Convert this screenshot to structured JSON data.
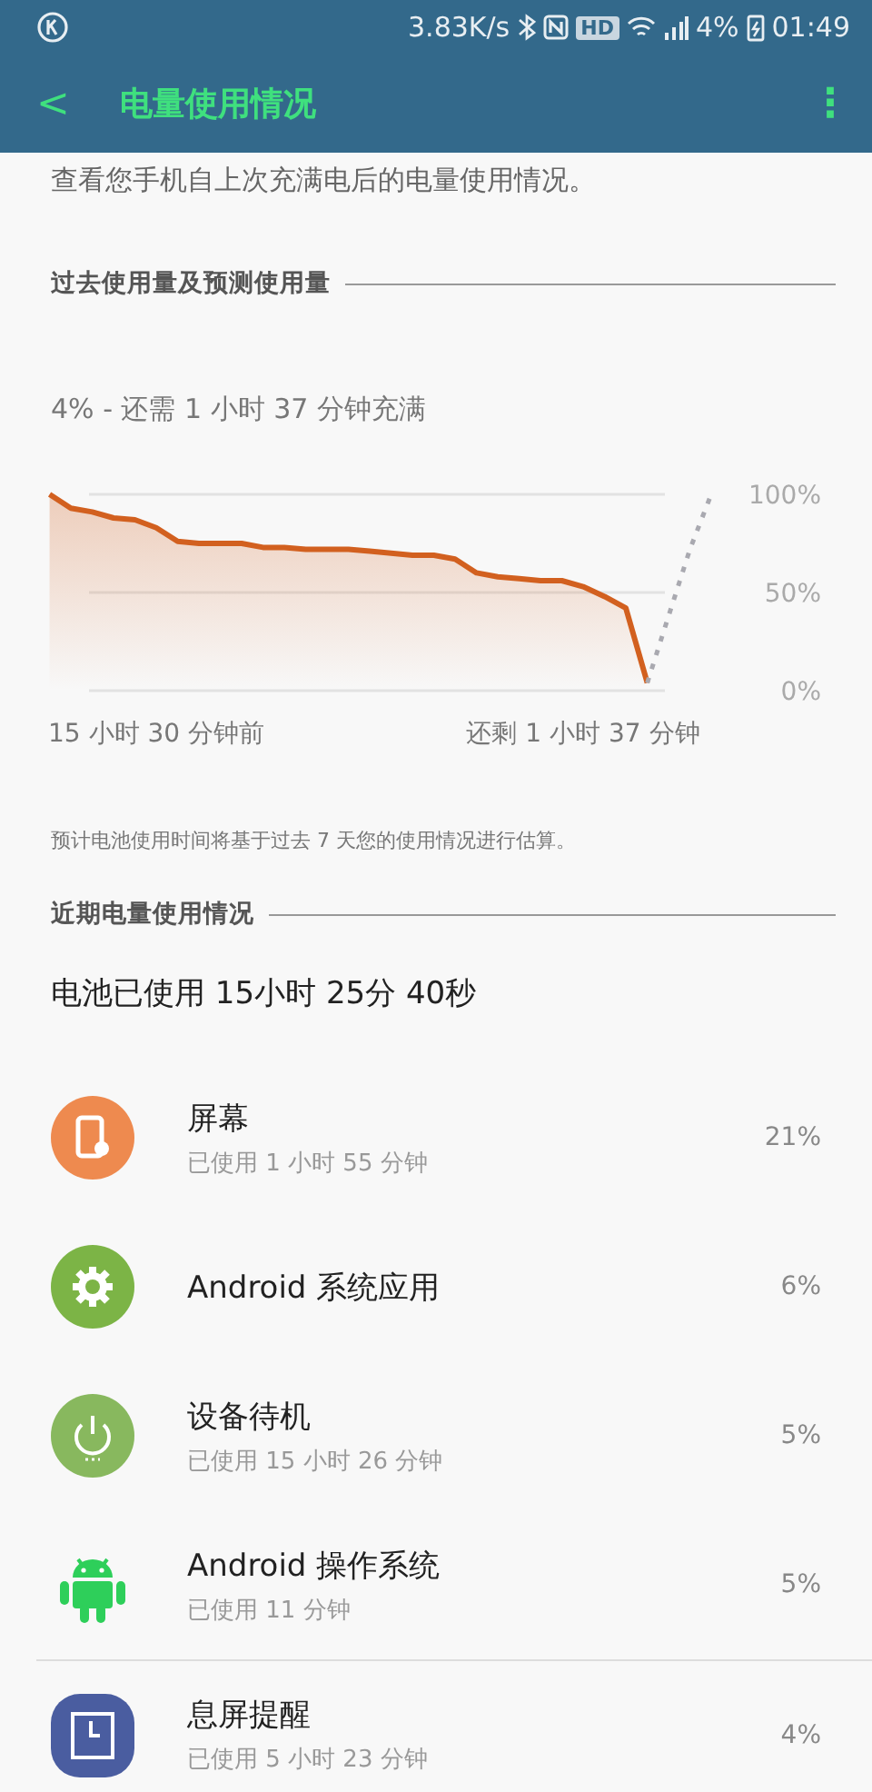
{
  "status_bar": {
    "speed": "3.83K/s",
    "hd": "HD",
    "battery": "4%",
    "time": "01:49"
  },
  "toolbar": {
    "back": "<",
    "title": "电量使用情况",
    "menu": "⋮"
  },
  "intro": "查看您手机自上次充满电后的电量使用情况。",
  "history": {
    "header": "过去使用量及预测使用量",
    "status": "4% - 还需 1 小时 37 分钟充满",
    "chart_data": {
      "type": "area",
      "categories": [
        null,
        null,
        null,
        null,
        null,
        "15 小时 30 分钟前",
        null,
        null,
        null,
        null,
        null,
        null,
        null,
        null,
        null,
        null,
        null,
        null,
        null,
        null,
        null,
        null,
        null,
        null,
        null,
        "还剩 1 小时 37 分钟",
        null,
        null,
        null,
        null,
        null,
        null
      ],
      "series": [
        {
          "color": "#d2601f",
          "values": [
            100,
            93,
            91,
            88,
            87,
            83,
            76,
            75,
            75,
            75,
            73,
            73,
            72,
            72,
            72,
            71,
            70,
            69,
            69,
            67,
            60,
            58,
            57,
            56,
            56,
            53,
            48,
            42,
            4,
            null,
            null,
            null
          ]
        },
        {
          "type": "line",
          "line_style": "dotted",
          "color": "#a9a9b0",
          "values": [
            null,
            null,
            null,
            null,
            null,
            null,
            null,
            null,
            null,
            null,
            null,
            null,
            null,
            null,
            null,
            null,
            null,
            null,
            null,
            null,
            null,
            null,
            null,
            null,
            null,
            null,
            null,
            null,
            4,
            38,
            72,
            100
          ]
        }
      ],
      "ylim": [
        0,
        100
      ],
      "yticks": [
        {
          "value": 100,
          "label": "100%"
        },
        {
          "value": 50,
          "label": "50%"
        },
        {
          "value": 0,
          "label": "0%"
        }
      ]
    },
    "note": "预计电池使用时间将基于过去 7 天您的使用情况进行估算。"
  },
  "recent": {
    "header": "近期电量使用情况",
    "total": "电池已使用 15小时 25分 40秒",
    "items": [
      {
        "kind": "screen",
        "name": "屏幕",
        "detail": "已使用 1 小时 55 分钟",
        "percent": "21%"
      },
      {
        "kind": "gear",
        "name": "Android 系统应用",
        "percent": "6%"
      },
      {
        "kind": "power",
        "name": "设备待机",
        "detail": "已使用 15 小时 26 分钟",
        "percent": "5%"
      },
      {
        "kind": "android",
        "name": "Android 操作系统",
        "detail": "已使用 11 分钟",
        "percent": "5%"
      },
      {
        "kind": "clock",
        "name": "息屏提醒",
        "detail": "已使用 5 小时 23 分钟",
        "percent": "4%"
      }
    ]
  }
}
